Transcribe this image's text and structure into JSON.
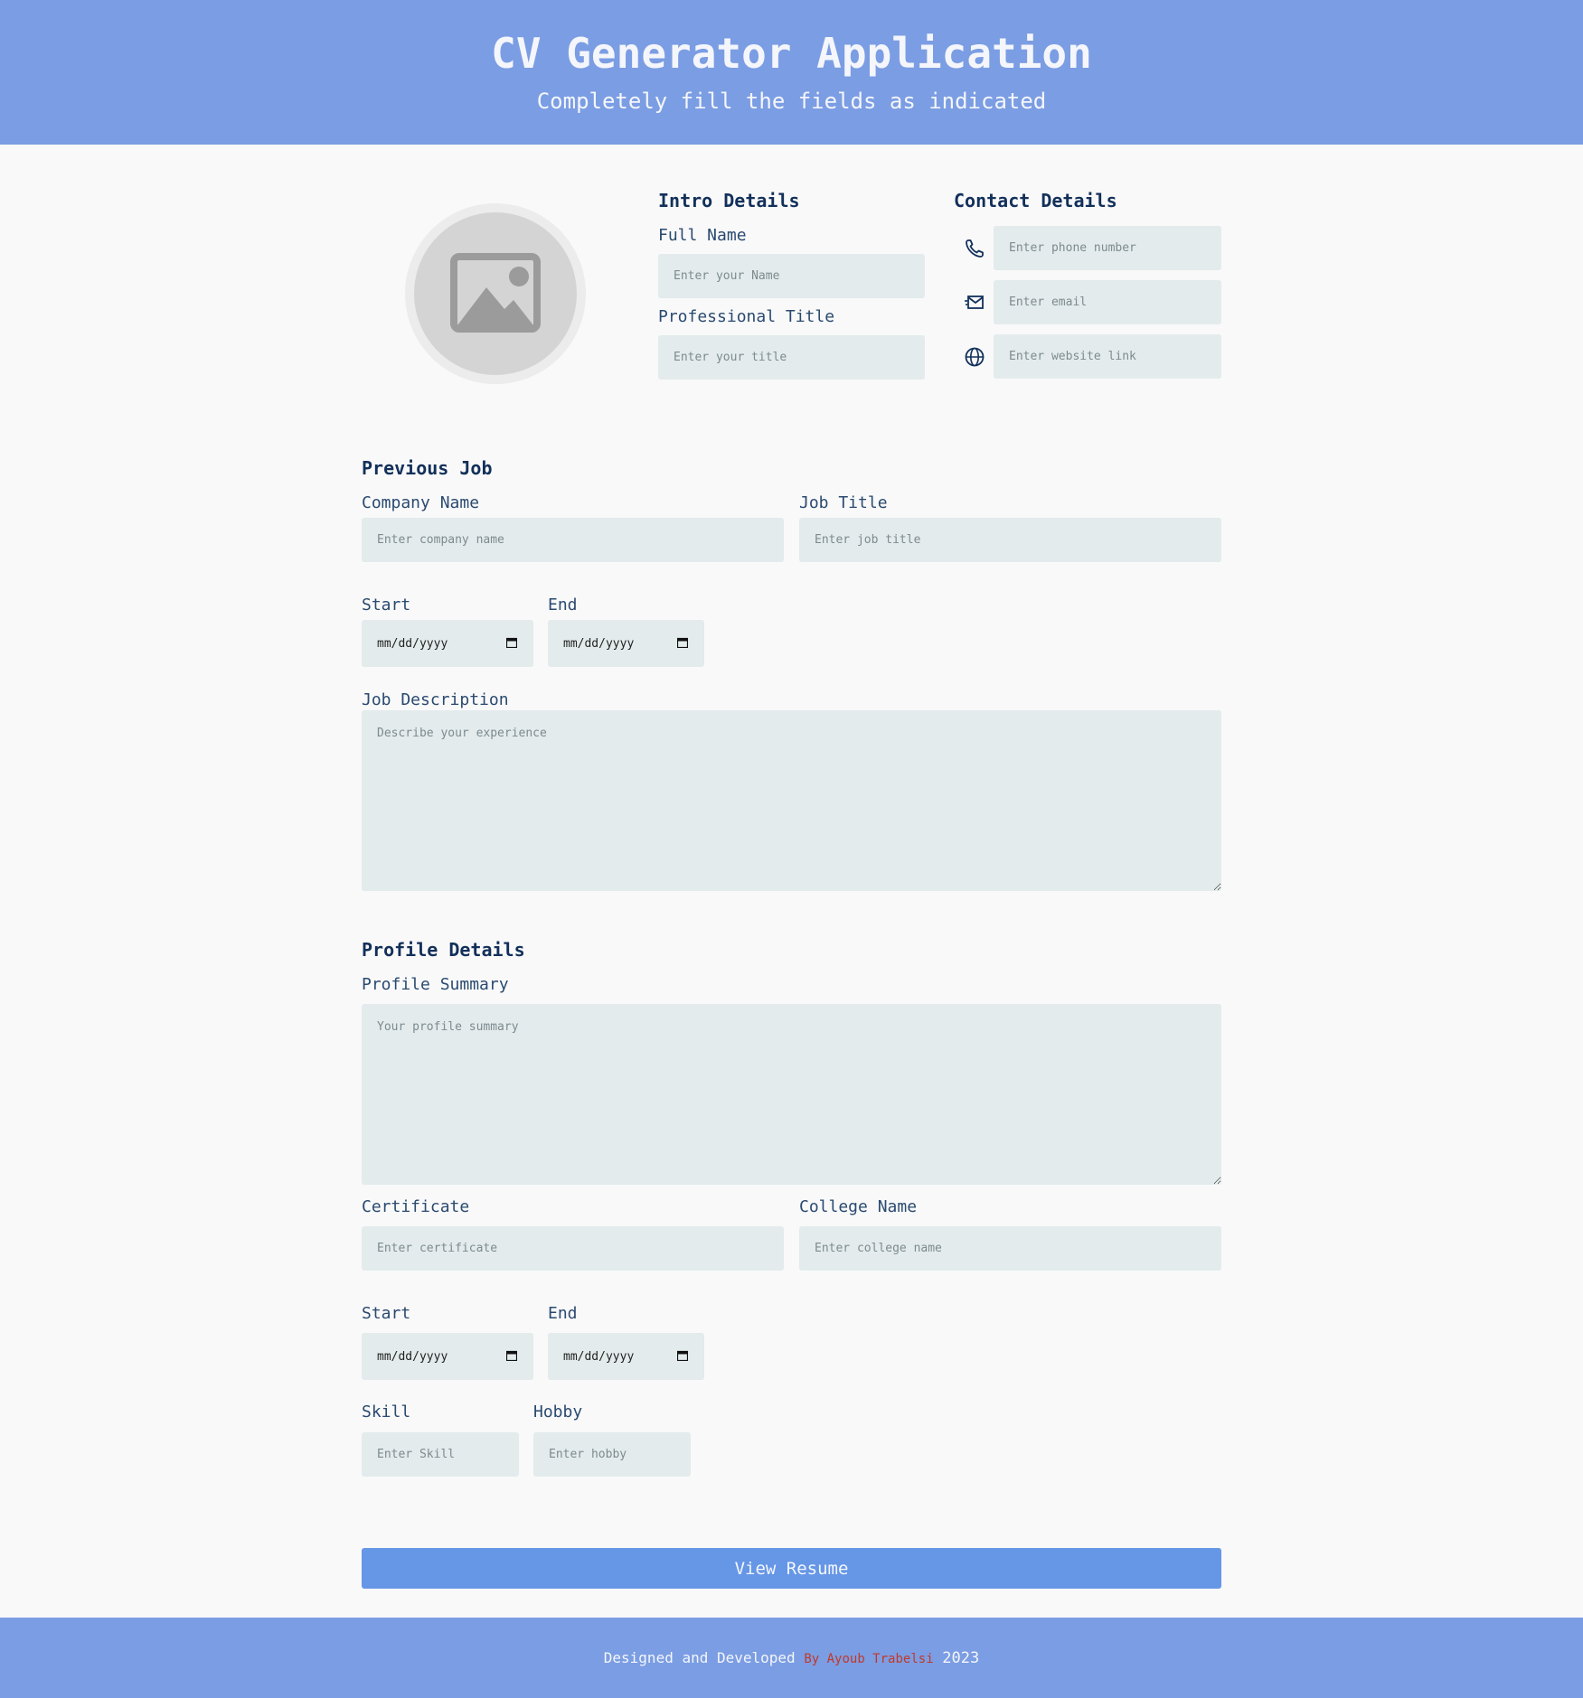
{
  "header": {
    "title": "CV Generator Application",
    "subtitle": "Completely fill the fields as indicated"
  },
  "intro": {
    "title": "Intro Details",
    "full_name_label": "Full Name",
    "full_name_placeholder": "Enter your Name",
    "prof_title_label": "Professional Title",
    "prof_title_placeholder": "Enter your title"
  },
  "contact": {
    "title": "Contact Details",
    "phone_placeholder": "Enter phone number",
    "email_placeholder": "Enter email",
    "website_placeholder": "Enter website link"
  },
  "job": {
    "title": "Previous Job",
    "company_label": "Company Name",
    "company_placeholder": "Enter company name",
    "job_title_label": "Job Title",
    "job_title_placeholder": "Enter job title",
    "start_label": "Start",
    "end_label": "End",
    "start_value": "mm/dd/yyyy",
    "end_value": "mm/dd/yyyy",
    "description_label": "Job Description",
    "description_placeholder": "Describe your experience"
  },
  "profile": {
    "title": "Profile Details",
    "summary_label": "Profile Summary",
    "summary_placeholder": "Your profile summary",
    "certificate_label": "Certificate",
    "certificate_placeholder": "Enter certificate",
    "college_label": "College Name",
    "college_placeholder": "Enter college name",
    "start_label": "Start",
    "end_label": "End",
    "start_value": "mm/dd/yyyy",
    "end_value": "mm/dd/yyyy",
    "skill_label": "Skill",
    "skill_placeholder": "Enter Skill",
    "hobby_label": "Hobby",
    "hobby_placeholder": "Enter hobby"
  },
  "actions": {
    "view_resume": "View Resume"
  },
  "footer": {
    "text": "Designed and Developed",
    "author": "By Ayoub Trabelsi",
    "year": "2023"
  },
  "colors": {
    "header_bg": "#7b9de3",
    "button_bg": "#6696e6",
    "field_bg": "#e3ebec",
    "author": "#c0392b"
  },
  "icons": [
    "image-placeholder-icon",
    "phone-icon",
    "mail-icon",
    "globe-icon",
    "calendar-icon"
  ]
}
